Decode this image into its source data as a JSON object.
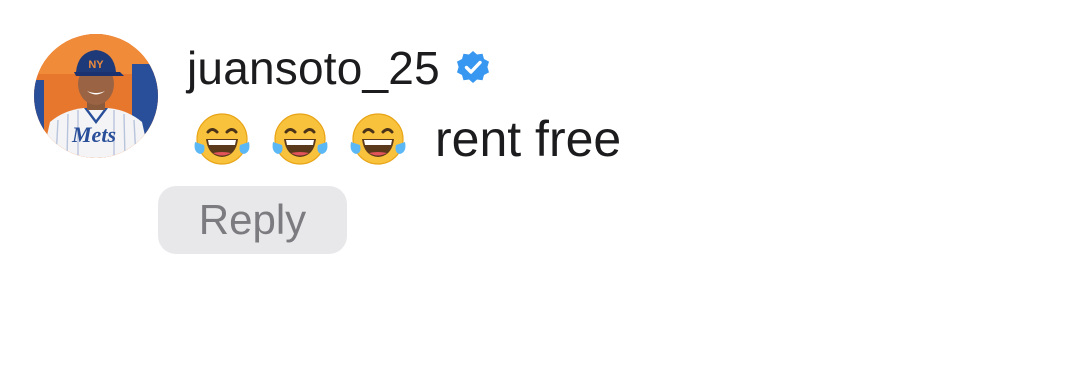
{
  "comment": {
    "username": "juansoto_25",
    "verified": true,
    "verified_color": "#3897f0",
    "emojis": [
      "face-with-tears-of-joy",
      "face-with-tears-of-joy",
      "face-with-tears-of-joy"
    ],
    "text": "rent free",
    "reply_label": "Reply",
    "avatar_jersey_text": "Mets"
  }
}
